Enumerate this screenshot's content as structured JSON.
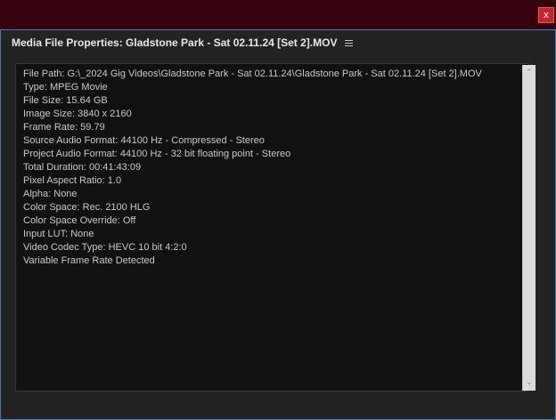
{
  "window": {
    "close_label": "x",
    "title": "Media File Properties: Gladstone Park - Sat 02.11.24 [Set 2].MOV"
  },
  "properties": [
    "File Path: G:\\_2024 Gig Videos\\Gladstone Park - Sat 02.11.24\\Gladstone Park - Sat 02.11.24 [Set 2].MOV",
    "Type: MPEG Movie",
    "File Size: 15.64 GB",
    "Image Size: 3840 x 2160",
    "Frame Rate: 59.79",
    "Source Audio Format: 44100 Hz - Compressed - Stereo",
    "Project Audio Format: 44100 Hz - 32 bit floating point - Stereo",
    "Total Duration: 00:41:43:09",
    "Pixel Aspect Ratio: 1.0",
    "Alpha: None",
    "Color Space: Rec. 2100 HLG",
    "Color Space Override: Off",
    "Input LUT: None",
    "Video Codec Type: HEVC 10 bit  4:2:0",
    "Variable Frame Rate Detected"
  ],
  "icons": {
    "close": "close-icon",
    "menu": "hamburger-menu-icon",
    "scroll_up": "chevron-up-icon",
    "scroll_down": "chevron-down-icon"
  },
  "colors": {
    "titlebar": "#35040f",
    "close_button": "#c4232b",
    "window_border": "#4c78b8",
    "panel_background": "#232323",
    "content_background": "#111111",
    "text": "#c9c9c9"
  }
}
